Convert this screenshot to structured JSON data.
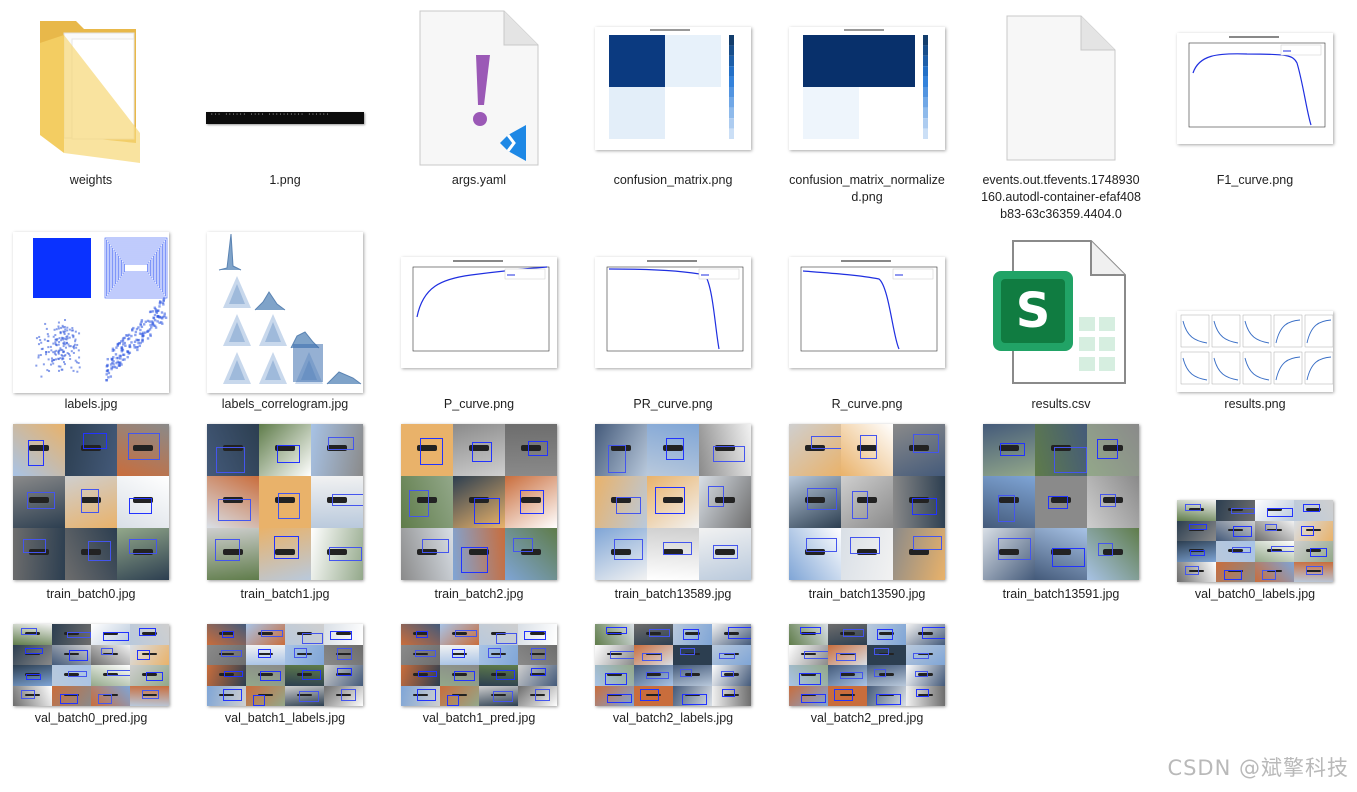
{
  "window": {
    "background": "#ffffff"
  },
  "files": [
    {
      "name": "weights",
      "kind": "folder",
      "icon": "folder-icon"
    },
    {
      "name": "1.png",
      "kind": "terminal"
    },
    {
      "name": "args.yaml",
      "kind": "yaml",
      "icon": "vscode-yaml-icon"
    },
    {
      "name": "confusion_matrix.png",
      "kind": "confusion"
    },
    {
      "name": "confusion_matrix_normalized.png",
      "kind": "confusion-norm"
    },
    {
      "name": "events.out.tfevents.1748930160.autodl-container-efaf408b83-63c36359.4404.0",
      "kind": "blank",
      "icon": "blank-file-icon"
    },
    {
      "name": "F1_curve.png",
      "kind": "curve-f1"
    },
    {
      "name": "labels.jpg",
      "kind": "labels"
    },
    {
      "name": "labels_correlogram.jpg",
      "kind": "correlogram"
    },
    {
      "name": "P_curve.png",
      "kind": "curve-p"
    },
    {
      "name": "PR_curve.png",
      "kind": "curve-pr"
    },
    {
      "name": "R_curve.png",
      "kind": "curve-r"
    },
    {
      "name": "results.csv",
      "kind": "csv",
      "icon": "excel-csv-icon"
    },
    {
      "name": "results.png",
      "kind": "results"
    },
    {
      "name": "train_batch0.jpg",
      "kind": "train",
      "seed": 1
    },
    {
      "name": "train_batch1.jpg",
      "kind": "train",
      "seed": 2
    },
    {
      "name": "train_batch2.jpg",
      "kind": "train",
      "seed": 3
    },
    {
      "name": "train_batch13589.jpg",
      "kind": "train",
      "seed": 4
    },
    {
      "name": "train_batch13590.jpg",
      "kind": "train",
      "seed": 5
    },
    {
      "name": "train_batch13591.jpg",
      "kind": "train",
      "seed": 6
    },
    {
      "name": "val_batch0_labels.jpg",
      "kind": "val",
      "seed": 7
    },
    {
      "name": "val_batch0_pred.jpg",
      "kind": "val",
      "seed": 7
    },
    {
      "name": "val_batch1_labels.jpg",
      "kind": "val",
      "seed": 8
    },
    {
      "name": "val_batch1_pred.jpg",
      "kind": "val",
      "seed": 8
    },
    {
      "name": "val_batch2_labels.jpg",
      "kind": "val",
      "seed": 9
    },
    {
      "name": "val_batch2_pred.jpg",
      "kind": "val",
      "seed": 9
    }
  ],
  "terminal_preview_text": "··· ······ ···· ·········· ······",
  "confusion_matrix": {
    "cells": [
      "#0b3a80",
      "#e7f1fa",
      "#e3eef9",
      "#ffffff"
    ]
  },
  "confusion_matrix_normalized": {
    "cells": [
      "#08306b",
      "#08306b",
      "#eef5fc",
      "#ffffff"
    ]
  },
  "watermark": "CSDN @斌擎科技"
}
